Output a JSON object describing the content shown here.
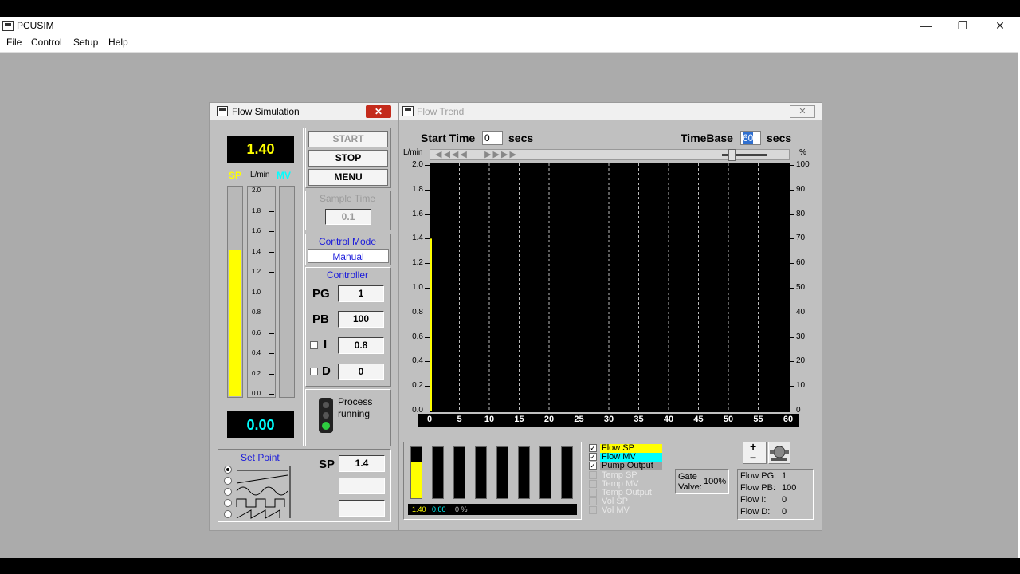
{
  "app": {
    "title": "PCUSIM"
  },
  "menu": [
    "File",
    "Control",
    "Setup",
    "Help"
  ],
  "flow_sim": {
    "title": "Flow Simulation",
    "sp_display": "1.40",
    "mv_display": "0.00",
    "sp_label": "SP",
    "unit": "L/min",
    "mv_label": "MV",
    "gauge_ticks": [
      "2.0",
      "1.8",
      "1.6",
      "1.4",
      "1.2",
      "1.0",
      "0.8",
      "0.6",
      "0.4",
      "0.2",
      "0.0"
    ],
    "sp_level": 0.7,
    "mv_level": 0.0,
    "buttons": {
      "start": "START",
      "stop": "STOP",
      "menu": "MENU"
    },
    "sample_time_label": "Sample Time",
    "sample_time": "0.1",
    "control_mode_label": "Control Mode",
    "control_mode": "Manual",
    "controller_label": "Controller",
    "pg_label": "PG",
    "pg": "1",
    "pb_label": "PB",
    "pb": "100",
    "i_label": "I",
    "i": "0.8",
    "d_label": "D",
    "d": "0",
    "process_status": "Process running",
    "setpoint_label": "Set Point",
    "sp_field_label": "SP",
    "sp_value": "1.4"
  },
  "trend": {
    "title": "Flow Trend",
    "start_time_label": "Start Time",
    "start_time": "0",
    "secs": "secs",
    "timebase_label": "TimeBase",
    "timebase": "60",
    "left_unit": "L/min",
    "right_unit": "%",
    "left_ticks": [
      "2.0",
      "1.8",
      "1.6",
      "1.4",
      "1.2",
      "1.0",
      "0.8",
      "0.6",
      "0.4",
      "0.2",
      "0.0"
    ],
    "right_ticks": [
      "100",
      "90",
      "80",
      "70",
      "60",
      "50",
      "40",
      "30",
      "20",
      "10",
      "0"
    ],
    "x_ticks": [
      "0",
      "5",
      "10",
      "15",
      "20",
      "25",
      "30",
      "35",
      "40",
      "45",
      "50",
      "55",
      "60"
    ],
    "meter_values": [
      "1.40",
      "0.00",
      "0 %"
    ],
    "legend": [
      {
        "label": "Flow SP",
        "checked": true,
        "color": "#ffff00"
      },
      {
        "label": "Flow MV",
        "checked": true,
        "color": "#00ffff"
      },
      {
        "label": "Pump Output",
        "checked": true,
        "color": "#a0a0a0"
      },
      {
        "label": "Temp SP",
        "checked": false,
        "color": ""
      },
      {
        "label": "Temp MV",
        "checked": false,
        "color": ""
      },
      {
        "label": "Temp Output",
        "checked": false,
        "color": ""
      },
      {
        "label": "Vol SP",
        "checked": false,
        "color": ""
      },
      {
        "label": "Vol MV",
        "checked": false,
        "color": ""
      }
    ],
    "gate_valve_label": "Gate Valve:",
    "gate_valve": "100%",
    "zoom_plus": "+",
    "zoom_minus": "−",
    "params": [
      {
        "label": "Flow PG:",
        "value": "1"
      },
      {
        "label": "Flow PB:",
        "value": "100"
      },
      {
        "label": "Flow I:",
        "value": "0"
      },
      {
        "label": "Flow D:",
        "value": "0"
      }
    ]
  },
  "colors": {
    "sp": "#ffff00",
    "mv": "#00ffff",
    "display_bg": "#000000"
  }
}
